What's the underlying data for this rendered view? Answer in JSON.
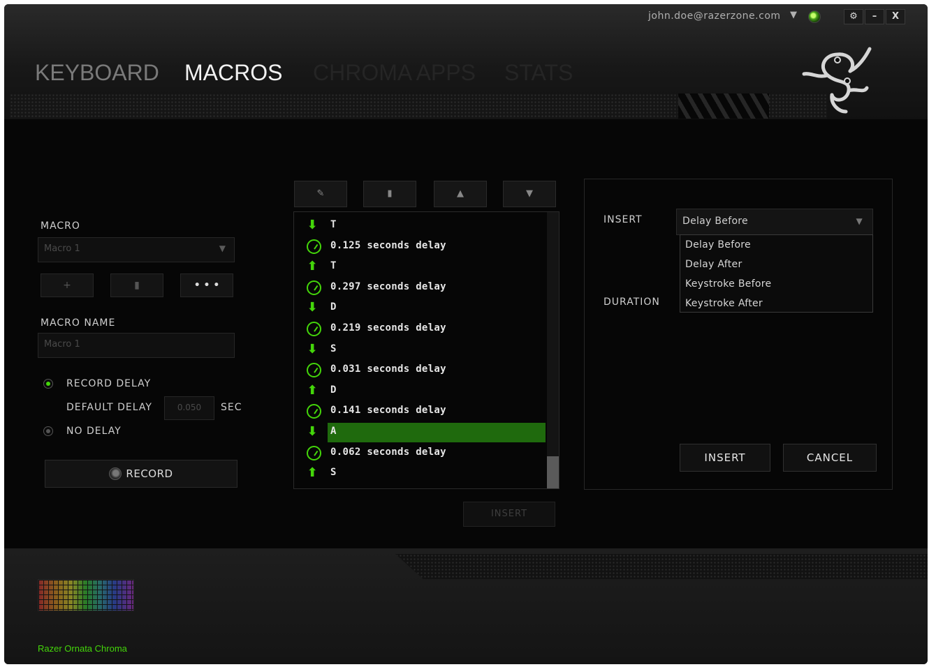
{
  "header": {
    "user_email": "john.doe@razerzone.com",
    "tabs": [
      {
        "label": "KEYBOARD"
      },
      {
        "label": "MACROS"
      },
      {
        "label": "CHROMA APPS"
      },
      {
        "label": "STATS"
      }
    ],
    "window_buttons": {
      "settings": "⚙",
      "minimize": "–",
      "close": "X"
    }
  },
  "left_panel": {
    "macro_label": "MACRO",
    "macro_select_value": "Macro 1",
    "macro_buttons": {
      "add": "+",
      "delete": "▮",
      "more": "• • •"
    },
    "macro_name_label": "MACRO NAME",
    "macro_name_value": "Macro 1",
    "record_delay_label": "RECORD DELAY",
    "default_delay_label": "DEFAULT DELAY",
    "default_delay_value": "0.050",
    "sec_label": "SEC",
    "no_delay_label": "NO DELAY",
    "record_label": "RECORD",
    "selected_option": "record_delay"
  },
  "toolbar": {
    "edit": "✎",
    "delete": "▮",
    "up": "▲",
    "down": "▼"
  },
  "events": [
    {
      "type": "down",
      "text": "T"
    },
    {
      "type": "delay",
      "text": "0.125 seconds delay"
    },
    {
      "type": "up",
      "text": "T"
    },
    {
      "type": "delay",
      "text": "0.297 seconds delay"
    },
    {
      "type": "down",
      "text": "D"
    },
    {
      "type": "delay",
      "text": "0.219 seconds delay"
    },
    {
      "type": "down",
      "text": "S"
    },
    {
      "type": "delay",
      "text": "0.031 seconds delay"
    },
    {
      "type": "up",
      "text": "D"
    },
    {
      "type": "delay",
      "text": "0.141 seconds delay"
    },
    {
      "type": "down",
      "text": "A",
      "selected": true
    },
    {
      "type": "delay",
      "text": "0.062 seconds delay"
    },
    {
      "type": "up",
      "text": "S"
    }
  ],
  "list_insert_label": "INSERT",
  "right_panel": {
    "insert_label": "INSERT",
    "insert_dropdown_value": "Delay Before",
    "dropdown_options": [
      "Delay Before",
      "Delay After",
      "Keystroke Before",
      "Keystroke After"
    ],
    "duration_label": "DURATION",
    "insert_button": "INSERT",
    "cancel_button": "CANCEL"
  },
  "footer": {
    "device_name": "Razer Ornata Chroma"
  },
  "colors": {
    "accent_green": "#44d60a",
    "selected_row": "#1f6a0d",
    "background": "#060606"
  }
}
